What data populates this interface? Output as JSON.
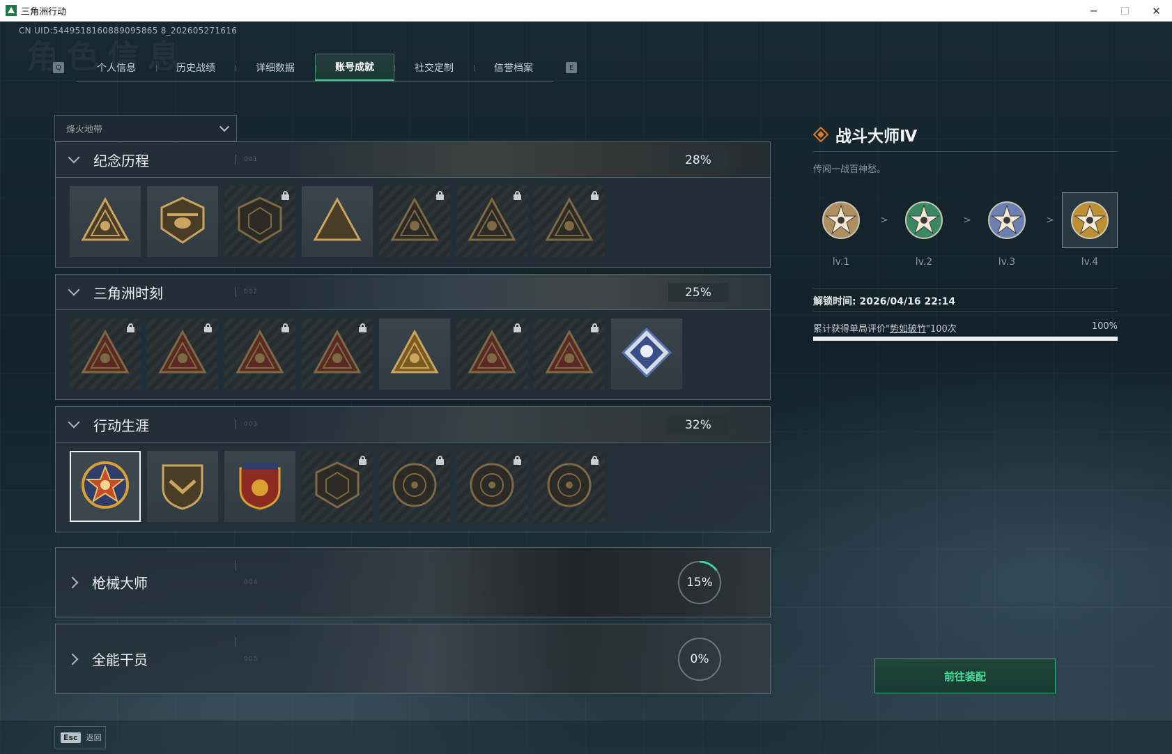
{
  "window": {
    "title": "三角洲行动",
    "minimize": "─",
    "maximize": "☐",
    "close": "✕"
  },
  "uid": "CN UID:5449518160889095865 8_202605271616",
  "ghost_title": "角色信息",
  "tabs": {
    "left_key": "Q",
    "right_key": "E",
    "items": [
      {
        "label": "个人信息"
      },
      {
        "label": "历史战绩"
      },
      {
        "label": "详细数据"
      },
      {
        "label": "账号成就",
        "active": true
      },
      {
        "label": "社交定制"
      },
      {
        "label": "信誉档案"
      }
    ]
  },
  "mode_select": {
    "value": "烽火地带"
  },
  "categories": [
    {
      "title": "纪念历程",
      "dots": "001",
      "percent": "28%",
      "expanded": true
    },
    {
      "title": "三角洲时刻",
      "dots": "002",
      "percent": "25%",
      "expanded": true
    },
    {
      "title": "行动生涯",
      "dots": "003",
      "percent": "32%",
      "expanded": true
    },
    {
      "title": "枪械大师",
      "dots": "004",
      "percent": "15%",
      "progress": 0.15,
      "expanded": false
    },
    {
      "title": "全能干员",
      "dots": "005",
      "percent": "0%",
      "progress": 0,
      "expanded": false
    }
  ],
  "badges": {
    "memorial": [
      {
        "icon": "triangle-emblem-icon",
        "locked": false
      },
      {
        "icon": "helicopter-badge-icon",
        "locked": false
      },
      {
        "icon": "shield-hex-icon",
        "locked": true
      },
      {
        "icon": "gold-triangle-crate-icon",
        "locked": false
      },
      {
        "icon": "triangle-vehicle-icon",
        "locked": true
      },
      {
        "icon": "triangle-soldier-icon",
        "locked": true
      },
      {
        "icon": "triangle-crossed-rifles-icon",
        "locked": true
      }
    ],
    "moments": [
      {
        "icon": "triangle-red-robot-icon",
        "locked": true
      },
      {
        "icon": "triangle-red-helmet-icon",
        "locked": true
      },
      {
        "icon": "triangle-red-runner-icon",
        "locked": true
      },
      {
        "icon": "triangle-red-star-icon",
        "locked": true
      },
      {
        "icon": "triangle-gold-team-icon",
        "locked": false
      },
      {
        "icon": "triangle-red-squad-icon",
        "locked": true
      },
      {
        "icon": "triangle-red-dragon-icon",
        "locked": true
      },
      {
        "icon": "diamond-fist-icon",
        "locked": false
      }
    ],
    "career": [
      {
        "icon": "star-medal-icon",
        "locked": false,
        "selected": true
      },
      {
        "icon": "shield-chevron-icon",
        "locked": false
      },
      {
        "icon": "crest-stars-icon",
        "locked": false
      },
      {
        "icon": "hex-shield-icon",
        "locked": true
      },
      {
        "icon": "round-shell-icon",
        "locked": true
      },
      {
        "icon": "round-skull-icon",
        "locked": true
      },
      {
        "icon": "round-eye-icon",
        "locked": true
      }
    ]
  },
  "detail": {
    "title": "战斗大师Ⅳ",
    "description": "传闻一战百神愁。",
    "levels": [
      {
        "label": "lv.1",
        "color": "#c9a36a"
      },
      {
        "label": "lv.2",
        "color": "#3f9a6b"
      },
      {
        "label": "lv.3",
        "color": "#7e8fc9"
      },
      {
        "label": "lv.4",
        "color": "#d9a032"
      }
    ],
    "arrow": ">",
    "unlock_time": "解锁时间: 2026/04/16 22:14",
    "requirement_prefix": "累计获得单局评价\"",
    "requirement_link": "势如破竹",
    "requirement_suffix": "\"100次",
    "requirement_percent": "100%",
    "requirement_progress": 1.0,
    "equip_button": "前往装配"
  },
  "footer": {
    "esc_key": "Esc",
    "back_label": "返回"
  },
  "colors": {
    "accent": "#38d69a",
    "rank_orange": "#e07b2a"
  }
}
